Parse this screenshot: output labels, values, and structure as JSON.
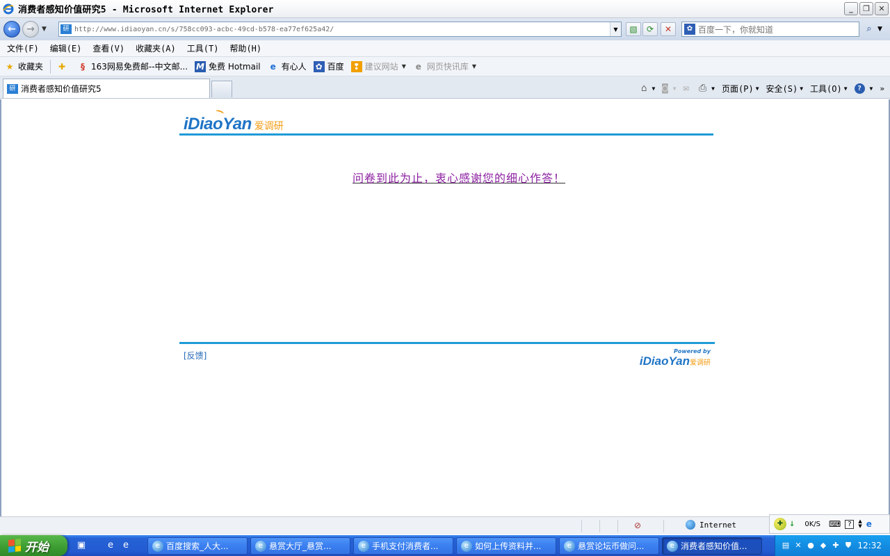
{
  "window": {
    "title": "消费者感知价值研究5 - Microsoft Internet Explorer",
    "buttons": [
      "_",
      "❐",
      "✕"
    ]
  },
  "address": {
    "url": "http://www.idiaoyan.cn/s/758cc093-acbc-49cd-b578-ea77ef625a42/",
    "favicon_text": "研"
  },
  "search": {
    "placeholder": "百度一下，你就知道"
  },
  "menu": [
    "文件(F)",
    "编辑(E)",
    "查看(V)",
    "收藏夹(A)",
    "工具(T)",
    "帮助(H)"
  ],
  "favorites": {
    "label": "收藏夹",
    "items": [
      {
        "label": "163网易免费邮--中文邮...",
        "icon": "163-icon"
      },
      {
        "label": "免费 Hotmail",
        "icon": "msn-icon"
      },
      {
        "label": "有心人",
        "icon": "ie-icon"
      },
      {
        "label": "百度",
        "icon": "baidu-paw-icon"
      },
      {
        "label": "建议网站",
        "icon": "suggested-sites-icon",
        "dropdown": true,
        "dim": true
      },
      {
        "label": "网页快讯库",
        "icon": "web-slice-icon",
        "dropdown": true,
        "dim": true
      }
    ]
  },
  "tab": {
    "label": "消费者感知价值研究5",
    "favicon_text": "研"
  },
  "commandbar": {
    "page": "页面(P)",
    "safety": "安全(S)",
    "tools": "工具(O)",
    "help": "?"
  },
  "page": {
    "logo_latin": "iDiaoYan",
    "logo_cn": "爱调研",
    "thanks": "问卷到此为止，衷心感谢您的细心作答！",
    "feedback": "[反馈]",
    "powered_by": "Powered by",
    "footer_logo_latin": "iDiaoYan",
    "footer_logo_cn": "爱调研"
  },
  "status": {
    "zone": "Internet",
    "netspeed": "0K/S"
  },
  "taskbar": {
    "start": "开始",
    "tasks": [
      {
        "label": "百度搜索_人大...",
        "active": false
      },
      {
        "label": "悬赏大厅_悬赏...",
        "active": false
      },
      {
        "label": "手机支付消费者...",
        "active": false
      },
      {
        "label": "如何上传资料并...",
        "active": false
      },
      {
        "label": "悬赏论坛币做问...",
        "active": false
      },
      {
        "label": "消费者感知价值...",
        "active": true
      }
    ],
    "clock": "12:32"
  }
}
